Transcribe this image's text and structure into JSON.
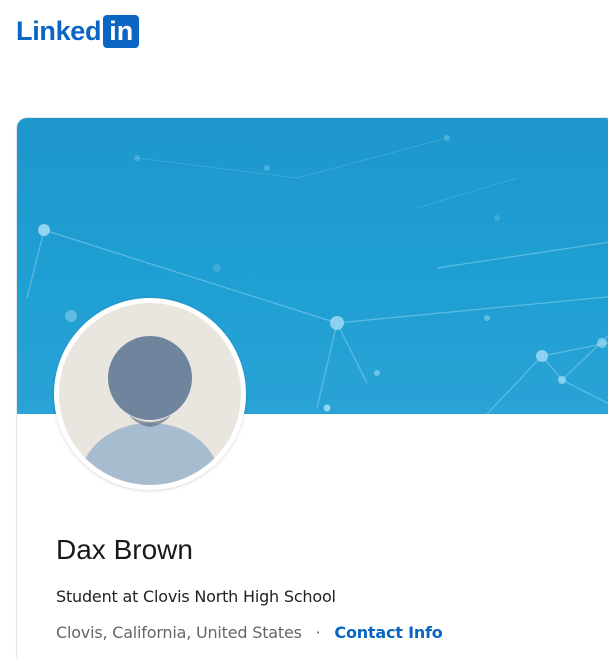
{
  "logo": {
    "text": "Linked",
    "box_text": "in",
    "brand_color": "#0a66c2"
  },
  "profile": {
    "banner_color": "#1f9fd3",
    "avatar_icon": "default-avatar-icon",
    "name": "Dax Brown",
    "headline": "Student at Clovis North High School",
    "location": "Clovis, California, United States",
    "separator": "·",
    "contact_link": "Contact Info"
  }
}
